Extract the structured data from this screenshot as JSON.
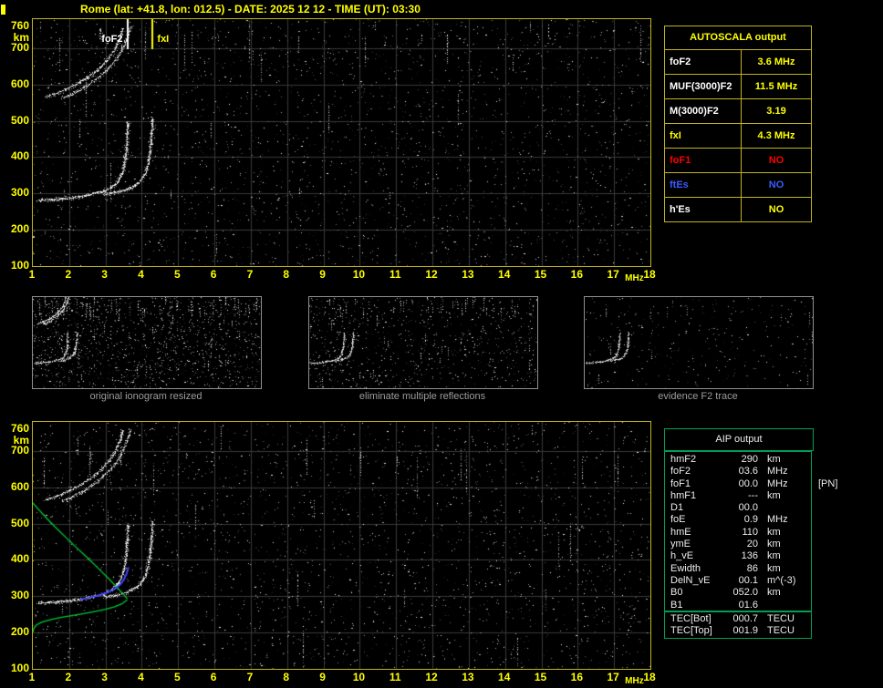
{
  "title": "Rome (lat: +41.8, lon: 012.5) - DATE: 2025 12 12 - TIME (UT): 03:30",
  "markers": {
    "foF2_label": "foF2",
    "fxI_label": "fxI",
    "foF2_MHz": 3.6,
    "fxI_MHz": 4.3
  },
  "axis": {
    "x_unit": "MHz",
    "y_unit": "km",
    "x_ticks": [
      1,
      2,
      3,
      4,
      5,
      6,
      7,
      8,
      9,
      10,
      11,
      12,
      13,
      14,
      15,
      16,
      17,
      18
    ],
    "y_ticks": [
      760,
      700,
      600,
      500,
      400,
      300,
      200,
      100
    ],
    "grid_x": [
      2,
      3,
      4,
      5,
      6,
      7,
      8,
      9,
      10,
      11,
      12,
      13,
      14,
      15,
      16,
      17
    ],
    "grid_y": [
      200,
      300,
      400,
      500,
      600,
      700
    ]
  },
  "autoscala_table": {
    "header": "AUTOSCALA output",
    "rows": [
      {
        "label": "foF2",
        "value": "3.6 MHz",
        "label_color": "#ffffff",
        "value_color": "#ffff00"
      },
      {
        "label": "MUF(3000)F2",
        "value": "11.5 MHz",
        "label_color": "#ffffff",
        "value_color": "#ffff00"
      },
      {
        "label": "M(3000)F2",
        "value": "3.19",
        "label_color": "#ffffff",
        "value_color": "#ffff00"
      },
      {
        "label": "fxI",
        "value": "4.3 MHz",
        "label_color": "#ffff00",
        "value_color": "#ffff00"
      },
      {
        "label": "foF1",
        "value": "NO",
        "label_color": "#ff0000",
        "value_color": "#ff0000"
      },
      {
        "label": "ftEs",
        "value": "NO",
        "label_color": "#3a5bff",
        "value_color": "#3a5bff"
      },
      {
        "label": "h'Es",
        "value": "NO",
        "label_color": "#ffffff",
        "value_color": "#ffff00"
      }
    ]
  },
  "aip_table": {
    "header": "AIP output",
    "rows": [
      {
        "label": "hmF2",
        "value": "290",
        "unit": "km"
      },
      {
        "label": "foF2",
        "value": "03.6",
        "unit": "MHz"
      },
      {
        "label": "foF1",
        "value": "00.0",
        "unit": "MHz",
        "note": "[PN]"
      },
      {
        "label": "hmF1",
        "value": "---",
        "unit": "km"
      },
      {
        "label": "D1",
        "value": "00.0",
        "unit": ""
      },
      {
        "label": "foE",
        "value": "0.9",
        "unit": "MHz"
      },
      {
        "label": "hmE",
        "value": "110",
        "unit": "km"
      },
      {
        "label": "ymE",
        "value": "20",
        "unit": "km"
      },
      {
        "label": "h_vE",
        "value": "136",
        "unit": "km"
      },
      {
        "label": "Ewidth",
        "value": "86",
        "unit": "km"
      },
      {
        "label": "DelN_vE",
        "value": "00.1",
        "unit": "m^(-3)"
      },
      {
        "label": "B0",
        "value": "052.0",
        "unit": "km"
      },
      {
        "label": "B1",
        "value": "01.6",
        "unit": ""
      }
    ],
    "tec_rows": [
      {
        "label": "TEC[Bot]",
        "value": "000.7",
        "unit": "TECU"
      },
      {
        "label": "TEC[Top]",
        "value": "001.9",
        "unit": "TECU"
      }
    ]
  },
  "panels": {
    "captions": [
      "original ionogram resized",
      "eliminate multiple reflections",
      "evidence F2 trace"
    ]
  },
  "colors": {
    "accent_yellow": "#ffff00",
    "border_yellow": "#c0b41e",
    "grid": "#3a3a3a",
    "green_border": "#00a050",
    "profile_green": "#00cc33",
    "profile_blue": "#4444ff",
    "red": "#ff0000",
    "blue": "#3a5bff",
    "trace_white": "#ffffff",
    "caption_gray": "#9c9c9c"
  },
  "chart_data": {
    "type": "scatter",
    "title": "Autoscala ionogram - Rome 2025-12-12 03:30 UT",
    "xlabel": "MHz",
    "ylabel": "km",
    "xlim": [
      1,
      18
    ],
    "ylim": [
      100,
      760
    ],
    "scaled_values": {
      "foF2_MHz": 3.6,
      "MUF3000F2_MHz": 11.5,
      "M3000F2": 3.19,
      "fxI_MHz": 4.3
    },
    "traces": {
      "f2_ordinary": [
        [
          1.15,
          281
        ],
        [
          1.5,
          283
        ],
        [
          1.9,
          286
        ],
        [
          2.3,
          291
        ],
        [
          2.7,
          299
        ],
        [
          3.0,
          308
        ],
        [
          3.2,
          319
        ],
        [
          3.35,
          333
        ],
        [
          3.45,
          352
        ],
        [
          3.52,
          376
        ],
        [
          3.57,
          410
        ],
        [
          3.6,
          452
        ],
        [
          3.62,
          498
        ]
      ],
      "f2_extraordinary": [
        [
          2.95,
          297
        ],
        [
          3.25,
          302
        ],
        [
          3.55,
          309
        ],
        [
          3.78,
          319
        ],
        [
          3.97,
          334
        ],
        [
          4.1,
          355
        ],
        [
          4.18,
          384
        ],
        [
          4.24,
          422
        ],
        [
          4.28,
          465
        ],
        [
          4.3,
          505
        ]
      ],
      "second_hop_ordinary": [
        [
          1.35,
          565
        ],
        [
          1.6,
          573
        ],
        [
          1.85,
          583
        ],
        [
          2.1,
          595
        ],
        [
          2.35,
          609
        ],
        [
          2.6,
          625
        ],
        [
          2.85,
          645
        ],
        [
          3.05,
          667
        ],
        [
          3.25,
          695
        ],
        [
          3.4,
          727
        ],
        [
          3.48,
          757
        ]
      ],
      "second_hop_extraordinary": [
        [
          1.8,
          562
        ],
        [
          2.05,
          572
        ],
        [
          2.3,
          585
        ],
        [
          2.55,
          600
        ],
        [
          2.8,
          618
        ],
        [
          3.05,
          640
        ],
        [
          3.3,
          668
        ],
        [
          3.5,
          702
        ],
        [
          3.63,
          738
        ],
        [
          3.7,
          760
        ]
      ]
    },
    "profile": {
      "topside_green": [
        [
          1.0,
          557
        ],
        [
          1.15,
          540
        ],
        [
          1.35,
          518
        ],
        [
          1.6,
          492
        ],
        [
          1.9,
          463
        ],
        [
          2.2,
          434
        ],
        [
          2.5,
          406
        ],
        [
          2.8,
          377
        ],
        [
          3.1,
          347
        ],
        [
          3.35,
          321
        ],
        [
          3.5,
          305
        ],
        [
          3.6,
          293
        ]
      ],
      "bottomside_green": [
        [
          3.6,
          290
        ],
        [
          3.45,
          279
        ],
        [
          3.25,
          271
        ],
        [
          3.0,
          264
        ],
        [
          2.7,
          258
        ],
        [
          2.4,
          252
        ],
        [
          2.1,
          247
        ],
        [
          1.8,
          242
        ],
        [
          1.5,
          236
        ],
        [
          1.25,
          229
        ],
        [
          1.1,
          221
        ],
        [
          1.03,
          212
        ],
        [
          1.0,
          201
        ]
      ],
      "fitted_trace_blue": [
        [
          2.3,
          291
        ],
        [
          2.55,
          296
        ],
        [
          2.8,
          302
        ],
        [
          3.05,
          310
        ],
        [
          3.25,
          320
        ],
        [
          3.4,
          332
        ],
        [
          3.5,
          345
        ],
        [
          3.58,
          362
        ],
        [
          3.63,
          380
        ]
      ]
    },
    "noise": {
      "top": {
        "seed": 7,
        "dots": 3000,
        "streaks": 30
      },
      "bottom": {
        "seed": 13,
        "dots": 3000,
        "streaks": 30
      },
      "small_panels": [
        {
          "seed": 21,
          "dots": 1400,
          "streaks": 70
        },
        {
          "seed": 33,
          "dots": 900,
          "streaks": 45
        },
        {
          "seed": 47,
          "dots": 320,
          "streaks": 14
        }
      ]
    }
  }
}
